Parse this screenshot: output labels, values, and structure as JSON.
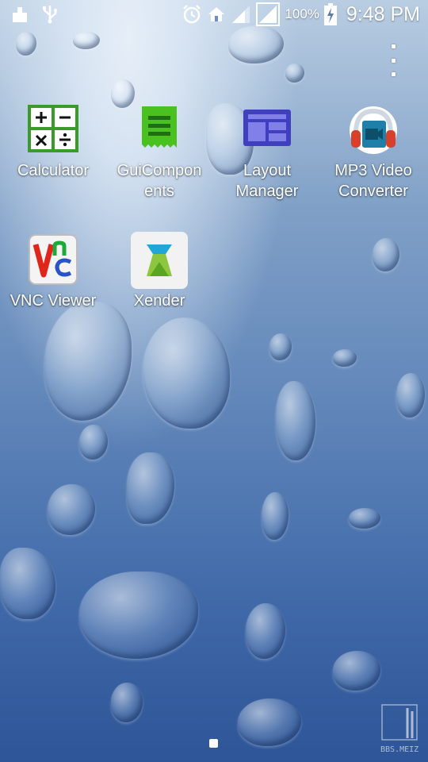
{
  "status_bar": {
    "left_icons": [
      "cleaner-icon",
      "usb-icon"
    ],
    "right_icons": [
      "alarm-icon",
      "home-icon",
      "signal-icon",
      "signal-icon-2"
    ],
    "battery_percent": "100%",
    "time": "9:48 PM"
  },
  "menu": {
    "overflow_icon": "more-vert-icon"
  },
  "apps": [
    {
      "label": "Calculator",
      "icon": "calculator-icon"
    },
    {
      "label": "GuiCompon\nents",
      "icon": "gui-components-icon"
    },
    {
      "label": "Layout\nManager",
      "icon": "layout-manager-icon"
    },
    {
      "label": "MP3 Video\nConverter",
      "icon": "mp3-video-converter-icon"
    },
    {
      "label": "VNC Viewer",
      "icon": "vnc-viewer-icon"
    },
    {
      "label": "Xender",
      "icon": "xender-icon"
    }
  ],
  "page_indicator": {
    "pages": 1,
    "current": 1
  },
  "watermark": {
    "text": "BBS.MEIZ"
  }
}
